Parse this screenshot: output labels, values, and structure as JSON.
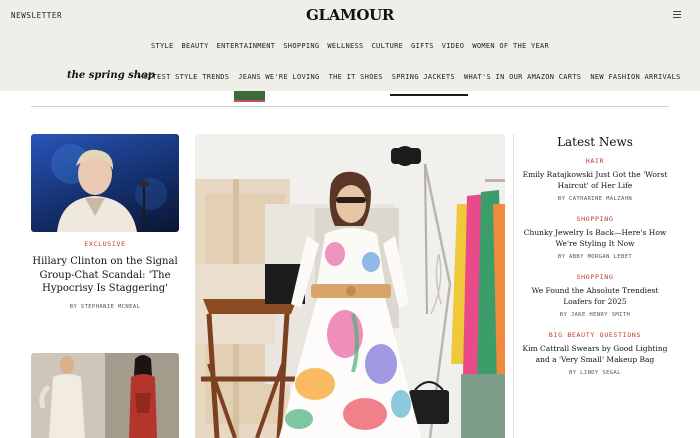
{
  "header": {
    "newsletter": "NEWSLETTER",
    "logo": "GLAMOUR"
  },
  "nav_primary": [
    "STYLE",
    "BEAUTY",
    "ENTERTAINMENT",
    "SHOPPING",
    "WELLNESS",
    "CULTURE",
    "GIFTS",
    "VIDEO",
    "WOMEN OF THE YEAR"
  ],
  "nav_secondary": {
    "brand": "the spring shop",
    "items": [
      "HOTTEST STYLE TRENDS",
      "JEANS WE'RE LOVING",
      "THE IT SHOES",
      "SPRING JACKETS",
      "WHAT'S IN OUR AMAZON CARTS",
      "NEW FASHION ARRIVALS"
    ]
  },
  "left_story": {
    "eyebrow": "EXCLUSIVE",
    "headline": "Hillary Clinton on the Signal Group-Chat Scandal: 'The Hypocrisy Is Staggering'",
    "byline": "BY STEPHANIE MCNEAL"
  },
  "latest": {
    "title": "Latest News",
    "items": [
      {
        "category": "HAIR",
        "headline": "Emily Ratajkowski Just Got the 'Worst Haircut' of Her Life",
        "byline": "BY CATHARINE MALZAHN"
      },
      {
        "category": "SHOPPING",
        "headline": "Chunky Jewelry Is Back—Here's How We're Styling It Now",
        "byline": "BY ABBY MORGAN LEBET"
      },
      {
        "category": "SHOPPING",
        "headline": "We Found the Absolute Trendiest Loafers for 2025",
        "byline": "BY JAKE HENRY SMITH"
      },
      {
        "category": "BIG BEAUTY QUESTIONS",
        "headline": "Kim Cattrall Swears by Good Lighting and a 'Very Small' Makeup Bag",
        "byline": "BY LINDY SEGAL"
      }
    ]
  },
  "colors": {
    "accent": "#c0392b",
    "header_bg": "#efeee9"
  }
}
